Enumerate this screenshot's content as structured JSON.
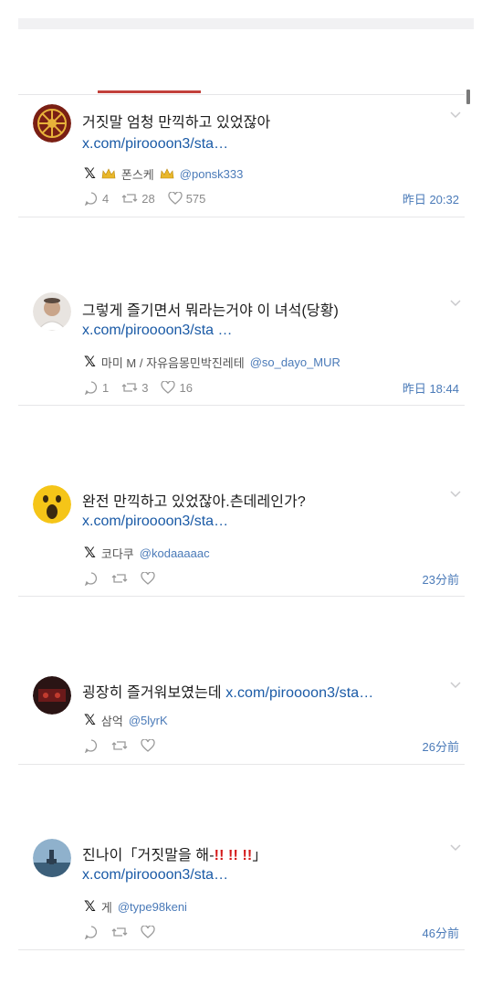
{
  "posts": [
    {
      "text": "거짓말 엄청 만끽하고 있었잖아",
      "link": "x.com/piroooon3/sta…",
      "author_name": "폰스케",
      "author_handle": "@ponsk333",
      "reply_count": "4",
      "repost_count": "28",
      "like_count": "575",
      "time": "昨日 20:32"
    },
    {
      "text": "그렇게 즐기면서 뭐라는거야 이 녀석(당황)",
      "link": "x.com/piroooon3/sta …",
      "author_name": "마미 M / 자유음몽민박진레테",
      "author_handle": "@so_dayo_MUR",
      "reply_count": "1",
      "repost_count": "3",
      "like_count": "16",
      "time": "昨日 18:44"
    },
    {
      "text": "완전 만끽하고 있었잖아.츤데레인가?",
      "link": "x.com/piroooon3/sta…",
      "author_name": "코다쿠",
      "author_handle": "@kodaaaaac",
      "time": "23分前"
    },
    {
      "text": "굉장히 즐거워보였는데",
      "link": "x.com/piroooon3/sta…",
      "author_name": "삼억",
      "author_handle": "@5lyrK",
      "time": "26分前"
    },
    {
      "text": "진나이「거짓말을 해-",
      "text_emph": "!!  !!  !!",
      "text_end": "」",
      "link": "x.com/piroooon3/sta…",
      "author_name": "게",
      "author_handle": "@type98keni",
      "time": "46分前"
    }
  ],
  "icons": {
    "platform": "x-logo-icon",
    "reply": "reply-icon",
    "repost": "repost-icon",
    "like": "heart-icon",
    "expand": "chevron-down-icon",
    "crown": "crown-icon"
  },
  "colors": {
    "link": "#1a5aa6",
    "handle": "#4a7ab8",
    "tab_indicator": "#c2413b",
    "emphasis": "#d41a1a"
  }
}
